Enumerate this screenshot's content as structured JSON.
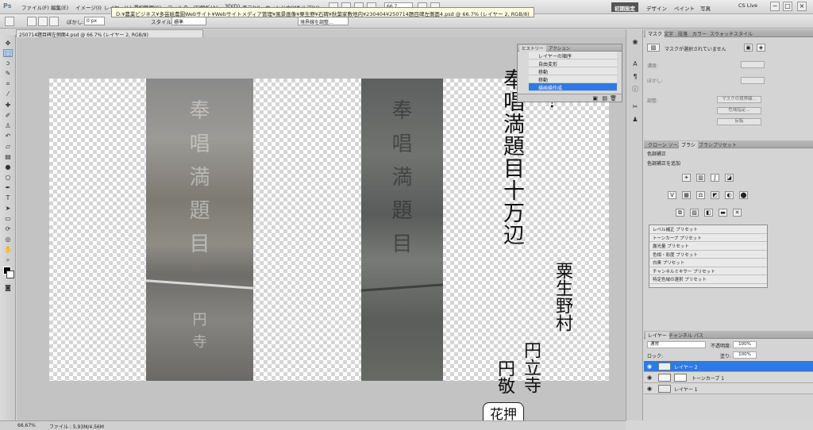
{
  "app": {
    "logo": "Ps"
  },
  "menubar": {
    "items": [
      "ファイル(F)",
      "編集(E)",
      "イメージ(I)",
      "レイヤー(L)",
      "選択範囲(S)",
      "フィルター(T)",
      "解析(A)",
      "3D(D)",
      "表示(V)",
      "ウィンドウ(W)",
      "ヘルプ(H)"
    ],
    "zoom": "66.7",
    "workspaces": [
      "初期設定",
      "デザイン",
      "ペイント",
      "写真"
    ],
    "active_workspace": "初期設定",
    "cs_live": "CS Live",
    "window_controls": [
      "−",
      "□",
      "×"
    ]
  },
  "options": {
    "feather_label": "ぼかし:",
    "feather_value": "0 px",
    "style_label": "スタイル:",
    "style_value": "標準",
    "refine_edge": "境界線を調整..."
  },
  "tooltip": {
    "path": "D:¥農業ビジネス¥多芸絵農園Webサイト¥Webサイトメディア管理¥風景画像¥栗生野¥石碑¥秋葉家敷地内¥230404¥250714題目碑左側面4.psd @ 66.7% (レイヤー 2, RGB/8)"
  },
  "document": {
    "tab_title": "250714題目碑左側面4.psd @ 66.7% (レイヤー 2, RGB/8)",
    "main_text": "奉唱満題目十万辺",
    "question_mark": "?",
    "village_text": "粟生野村",
    "temple_text": "円立寺",
    "name_text": "円敬",
    "kao_text": "花押"
  },
  "history": {
    "tabs": [
      "ヒストリー",
      "アクション"
    ],
    "rows": [
      "レイヤーの順序",
      "自由変形",
      "移動",
      "移動",
      "描画描作成"
    ],
    "active_index": 4
  },
  "dock": {
    "mask_tabs": [
      "マスク",
      "文字",
      "段落",
      "カラー",
      "スウォッチ",
      "スタイル"
    ],
    "mask_message": "マスクが選択されていません",
    "density_label": "濃度:",
    "feather_label": "ぼかし:",
    "refine_label": "調整:",
    "mask_buttons": [
      "マスクの境界線...",
      "色域指定...",
      "反転"
    ],
    "adj_tabs": [
      "クローン ソース",
      "ブラシ",
      "ブラシプリセット"
    ],
    "adj_title": "色調補正",
    "adj_subtitle": "色調補正を追加",
    "presets": [
      "レベル補正 プリセット",
      "トーンカーブ プリセット",
      "露光量 プリセット",
      "色相・彩度 プリセット",
      "白黒 プリセット",
      "チャンネルミキサー プリセット",
      "特定色域の選択 プリセット"
    ],
    "layer_tabs": [
      "レイヤー",
      "チャンネル",
      "パス"
    ],
    "blend_mode": "通常",
    "opacity_label": "不透明度:",
    "opacity_value": "100%",
    "lock_label": "ロック:",
    "fill_label": "塗り:",
    "fill_value": "100%",
    "layers": [
      {
        "name": "レイヤー 2",
        "active": true
      },
      {
        "name": "トーンカーブ 1",
        "active": false
      },
      {
        "name": "レイヤー 1",
        "active": false
      }
    ]
  },
  "status": {
    "zoom": "66.67%",
    "file": "ファイル : 5.93M/4.56M"
  }
}
